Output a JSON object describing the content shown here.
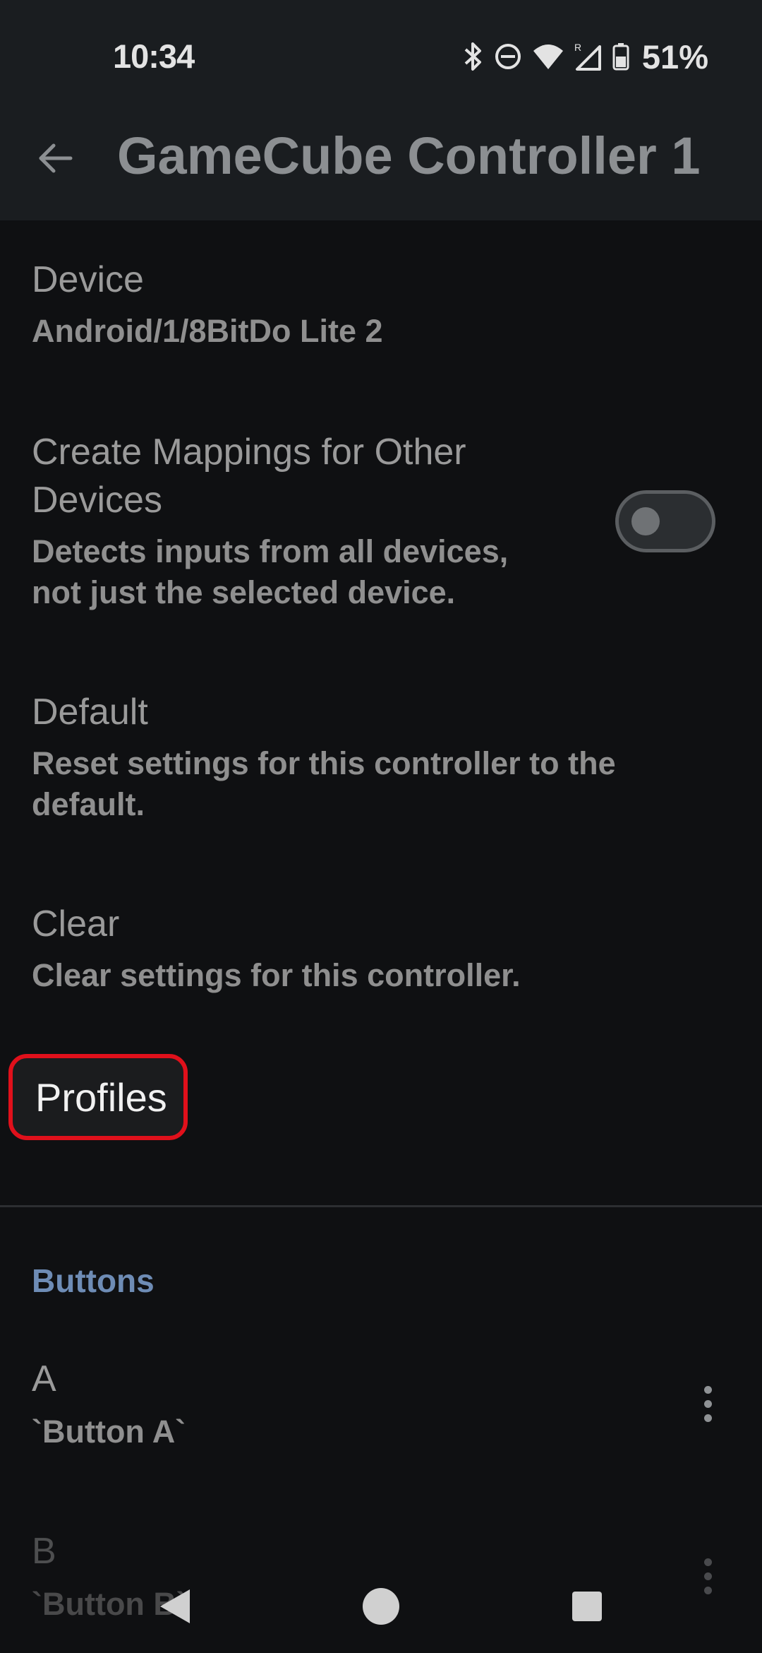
{
  "status_bar": {
    "time": "10:34",
    "battery": "51%",
    "icons": [
      "bluetooth-icon",
      "do-not-disturb-icon",
      "wifi-icon",
      "signal-roaming-icon",
      "battery-icon"
    ]
  },
  "app_bar": {
    "title": "GameCube Controller 1",
    "back_icon": "arrow-back-icon"
  },
  "settings": {
    "device": {
      "title": "Device",
      "summary": "Android/1/8BitDo Lite 2"
    },
    "other_devices": {
      "title_line1": "Create Mappings for Other",
      "title_line2": "Devices",
      "summary_line1": "Detects inputs from all devices,",
      "summary_line2": "not just the selected device.",
      "enabled": false
    },
    "default": {
      "title": "Default",
      "summary_line1": "Reset settings for this controller to the",
      "summary_line2": "default."
    },
    "clear": {
      "title": "Clear",
      "summary": "Clear settings for this controller."
    },
    "profiles": {
      "title": "Profiles"
    }
  },
  "buttons_section": {
    "header": "Buttons",
    "items": [
      {
        "title": "A",
        "summary": "`Button A`"
      },
      {
        "title": "B",
        "summary": "`Button B`"
      }
    ]
  },
  "colors": {
    "highlight": "#e0101b",
    "section_accent": "#6e8cb5"
  }
}
